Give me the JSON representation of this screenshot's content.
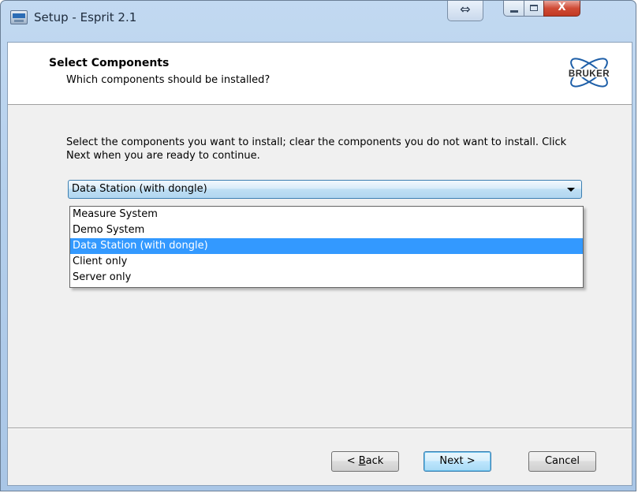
{
  "window": {
    "title": "Setup - Esprit 2.1",
    "resize_glyph": "⇔",
    "close_glyph": "X"
  },
  "header": {
    "title": "Select Components",
    "subtitle": "Which components should be installed?",
    "logo_text": "BRUKER"
  },
  "body": {
    "instructions": "Select the components you want to install; clear the components you do not want to install. Click Next when you are ready to continue."
  },
  "combo": {
    "selected": "Data Station (with dongle)",
    "options": [
      "Measure System",
      "Demo System",
      "Data Station (with dongle)",
      "Client only",
      "Server only"
    ],
    "selected_index": 2
  },
  "buttons": {
    "back_prefix": "< ",
    "back_accel": "B",
    "back_rest": "ack",
    "next": "Next >",
    "cancel": "Cancel"
  },
  "colors": {
    "selection": "#3399ff",
    "close_button": "#c23a24",
    "logo": "#1e5fa8"
  }
}
